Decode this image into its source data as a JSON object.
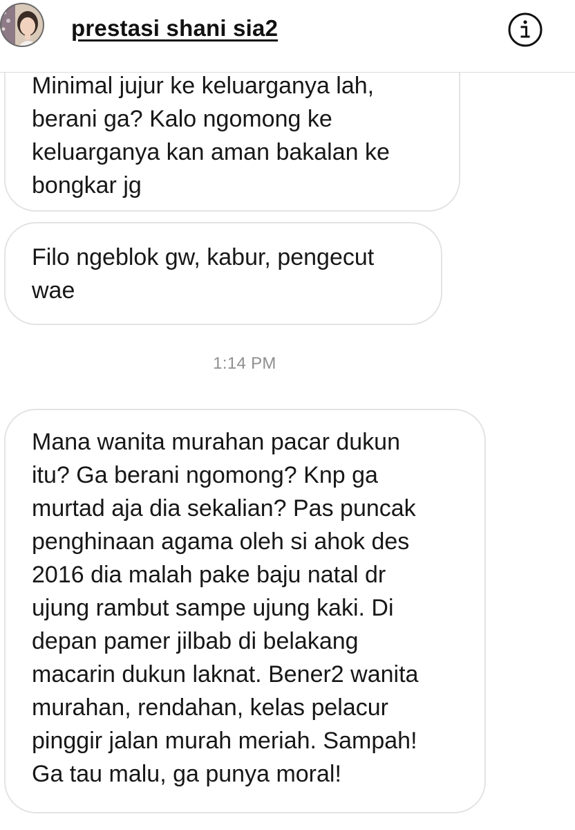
{
  "header": {
    "title": "prestasi shani sia2",
    "avatar_icon": "profile-photo",
    "info_icon": "info-icon"
  },
  "messages": [
    {
      "lines": [
        "Minimal jujur ke keluarganya lah,",
        "berani ga?  Kalo ngomong ke",
        "keluarganya kan aman bakalan ke",
        "bongkar jg"
      ]
    },
    {
      "lines": [
        "Filo ngeblok gw, kabur, pengecut",
        "wae"
      ]
    },
    {
      "lines": [
        "Mana wanita murahan pacar dukun",
        "itu? Ga berani ngomong? Knp ga",
        "murtad aja dia sekalian? Pas puncak",
        "penghinaan agama oleh si ahok des",
        "2016 dia malah pake baju natal dr",
        "ujung rambut sampe ujung kaki. Di",
        "depan pamer jilbab di belakang",
        "macarin dukun laknat. Bener2 wanita",
        "murahan, rendahan, kelas pelacur",
        "pinggir jalan murah meriah. Sampah!",
        "Ga tau malu, ga punya moral!"
      ]
    }
  ],
  "timestamp": "1:14 PM",
  "colors": {
    "bubble_border": "#e3e3e3",
    "timestamp": "#8e8e8e",
    "text": "#171717"
  }
}
